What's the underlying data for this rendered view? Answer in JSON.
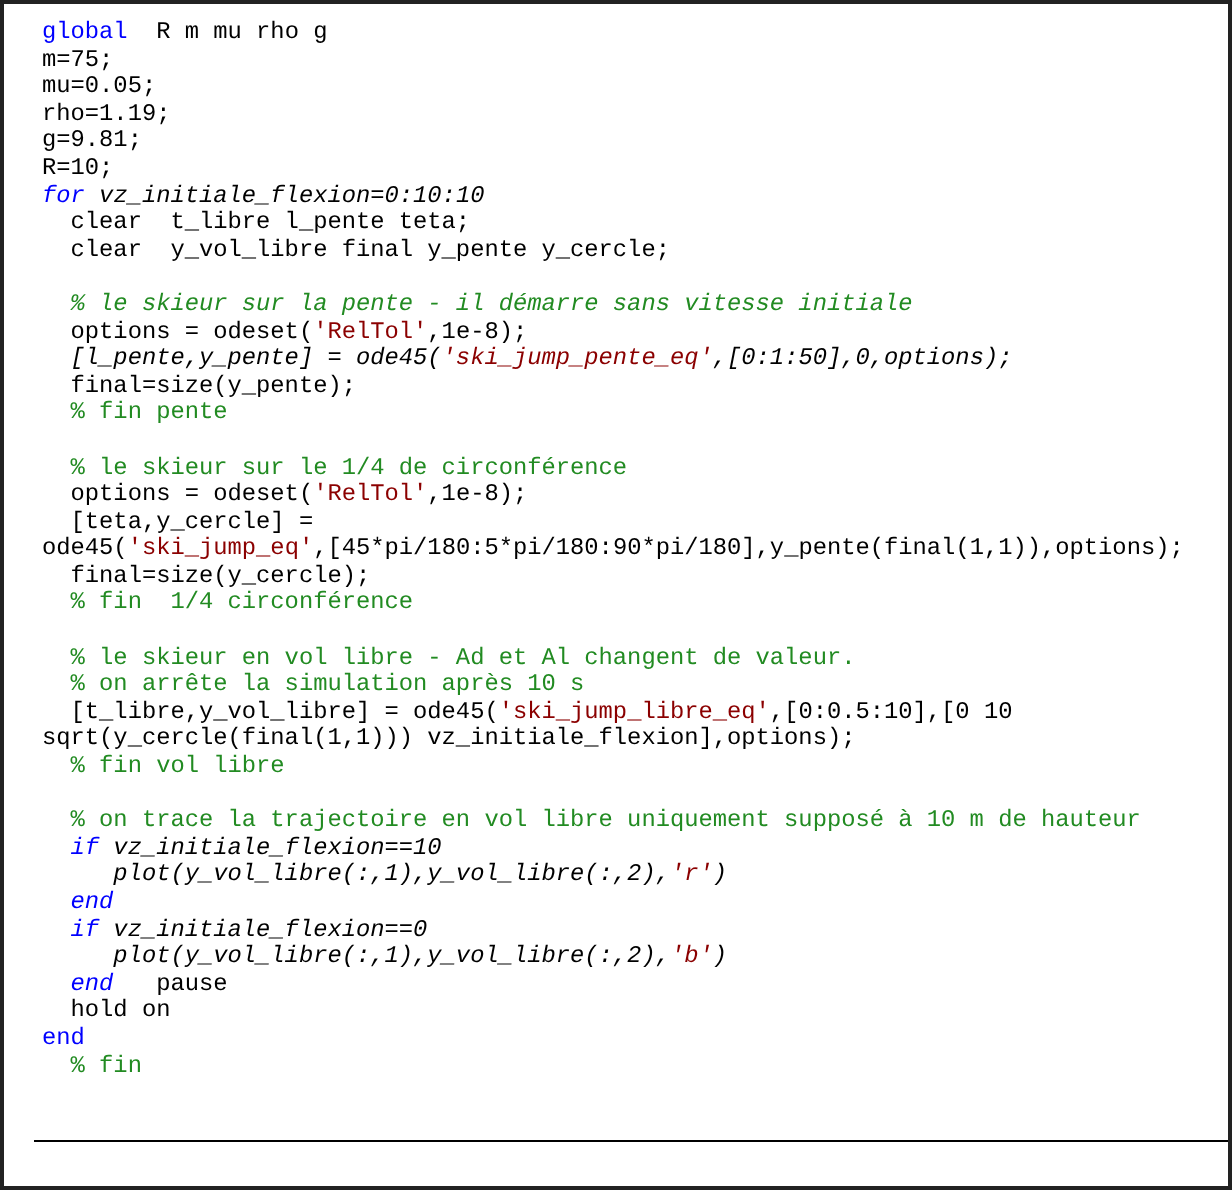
{
  "code_lines": [
    {
      "kind": "code",
      "segments": [
        {
          "text": "global",
          "kind": "keyword"
        },
        {
          "text": "  R m mu rho g",
          "kind": "plain"
        }
      ]
    },
    {
      "kind": "code",
      "segments": [
        {
          "text": "m=75;",
          "kind": "plain"
        }
      ]
    },
    {
      "kind": "code",
      "segments": [
        {
          "text": "mu=0.05;",
          "kind": "plain"
        }
      ]
    },
    {
      "kind": "code",
      "segments": [
        {
          "text": "rho=1.19;",
          "kind": "plain"
        }
      ]
    },
    {
      "kind": "code",
      "segments": [
        {
          "text": "g=9.81;",
          "kind": "plain"
        }
      ]
    },
    {
      "kind": "code",
      "segments": [
        {
          "text": "R=10;",
          "kind": "plain"
        }
      ]
    },
    {
      "kind": "code",
      "segments": [
        {
          "text": "for",
          "kind": "keyword",
          "italic": true
        },
        {
          "text": " vz_initiale_flexion=0:10:10",
          "kind": "plain",
          "italic": true
        }
      ]
    },
    {
      "kind": "code",
      "segments": [
        {
          "text": "  clear  t_libre l_pente teta;",
          "kind": "plain"
        }
      ]
    },
    {
      "kind": "code",
      "segments": [
        {
          "text": "  clear  y_vol_libre final y_pente y_cercle;",
          "kind": "plain"
        }
      ]
    },
    {
      "kind": "blank"
    },
    {
      "kind": "code",
      "segments": [
        {
          "text": "  % le skieur sur la pente - il démarre sans vitesse initiale",
          "kind": "comment",
          "italic": true
        }
      ]
    },
    {
      "kind": "code",
      "segments": [
        {
          "text": "  options = odeset(",
          "kind": "plain"
        },
        {
          "text": "'RelTol'",
          "kind": "string"
        },
        {
          "text": ",1e-8);",
          "kind": "plain"
        }
      ]
    },
    {
      "kind": "code",
      "segments": [
        {
          "text": "  [l_pente,y_pente] = ode45(",
          "kind": "plain",
          "italic": true
        },
        {
          "text": "'ski_jump_pente_eq'",
          "kind": "string",
          "italic": true
        },
        {
          "text": ",[0:1:50],0,options);",
          "kind": "plain",
          "italic": true
        }
      ]
    },
    {
      "kind": "code",
      "segments": [
        {
          "text": "  final=size(y_pente);",
          "kind": "plain"
        }
      ]
    },
    {
      "kind": "code",
      "segments": [
        {
          "text": "  % fin pente",
          "kind": "comment"
        }
      ]
    },
    {
      "kind": "blank"
    },
    {
      "kind": "code",
      "segments": [
        {
          "text": "  % le skieur sur le 1/4 de circonférence",
          "kind": "comment"
        }
      ]
    },
    {
      "kind": "code",
      "segments": [
        {
          "text": "  options = odeset(",
          "kind": "plain"
        },
        {
          "text": "'RelTol'",
          "kind": "string"
        },
        {
          "text": ",1e-8);",
          "kind": "plain"
        }
      ]
    },
    {
      "kind": "code",
      "segments": [
        {
          "text": "  [teta,y_cercle] =",
          "kind": "plain"
        }
      ]
    },
    {
      "kind": "code",
      "segments": [
        {
          "text": "ode45(",
          "kind": "plain"
        },
        {
          "text": "'ski_jump_eq'",
          "kind": "string"
        },
        {
          "text": ",[45*pi/180:5*pi/180:90*pi/180],y_pente(final(1,1)),options);",
          "kind": "plain"
        }
      ]
    },
    {
      "kind": "code",
      "segments": [
        {
          "text": "  final=size(y_cercle);",
          "kind": "plain"
        }
      ]
    },
    {
      "kind": "code",
      "segments": [
        {
          "text": "  % fin  1/4 circonférence",
          "kind": "comment"
        }
      ]
    },
    {
      "kind": "blank"
    },
    {
      "kind": "code",
      "segments": [
        {
          "text": "  % le skieur en vol libre - Ad et Al changent de valeur.",
          "kind": "comment"
        }
      ]
    },
    {
      "kind": "code",
      "segments": [
        {
          "text": "  % on arrête la simulation après 10 s",
          "kind": "comment"
        }
      ]
    },
    {
      "kind": "code",
      "segments": [
        {
          "text": "  [t_libre,y_vol_libre] = ode45(",
          "kind": "plain"
        },
        {
          "text": "'ski_jump_libre_eq'",
          "kind": "string"
        },
        {
          "text": ",[0:0.5:10],[0 10",
          "kind": "plain"
        }
      ]
    },
    {
      "kind": "code",
      "segments": [
        {
          "text": "sqrt(y_cercle(final(1,1))) vz_initiale_flexion],options);",
          "kind": "plain"
        }
      ]
    },
    {
      "kind": "code",
      "segments": [
        {
          "text": "  % fin vol libre",
          "kind": "comment"
        }
      ]
    },
    {
      "kind": "blank"
    },
    {
      "kind": "code",
      "segments": [
        {
          "text": "  % on trace la trajectoire en vol libre uniquement supposé à 10 m de hauteur",
          "kind": "comment"
        }
      ]
    },
    {
      "kind": "code",
      "segments": [
        {
          "text": "  if",
          "kind": "keyword",
          "italic": true
        },
        {
          "text": " vz_initiale_flexion==10",
          "kind": "plain",
          "italic": true
        }
      ]
    },
    {
      "kind": "code",
      "segments": [
        {
          "text": "     plot(y_vol_libre(:,1),y_vol_libre(:,2),",
          "kind": "plain",
          "italic": true
        },
        {
          "text": "'r'",
          "kind": "string",
          "italic": true
        },
        {
          "text": ")",
          "kind": "plain",
          "italic": true
        }
      ]
    },
    {
      "kind": "code",
      "segments": [
        {
          "text": "  end",
          "kind": "keyword",
          "italic": true
        }
      ]
    },
    {
      "kind": "code",
      "segments": [
        {
          "text": "  if",
          "kind": "keyword",
          "italic": true
        },
        {
          "text": " vz_initiale_flexion==0",
          "kind": "plain",
          "italic": true
        }
      ]
    },
    {
      "kind": "code",
      "segments": [
        {
          "text": "     plot(y_vol_libre(:,1),y_vol_libre(:,2),",
          "kind": "plain",
          "italic": true
        },
        {
          "text": "'b'",
          "kind": "string",
          "italic": true
        },
        {
          "text": ")",
          "kind": "plain",
          "italic": true
        }
      ]
    },
    {
      "kind": "code",
      "segments": [
        {
          "text": "  end",
          "kind": "keyword",
          "italic": true
        },
        {
          "text": "   pause",
          "kind": "plain"
        }
      ]
    },
    {
      "kind": "code",
      "segments": [
        {
          "text": "  hold on",
          "kind": "plain"
        }
      ]
    },
    {
      "kind": "code",
      "segments": [
        {
          "text": "end",
          "kind": "keyword"
        }
      ]
    },
    {
      "kind": "code",
      "segments": [
        {
          "text": "  % fin",
          "kind": "comment"
        }
      ]
    }
  ]
}
